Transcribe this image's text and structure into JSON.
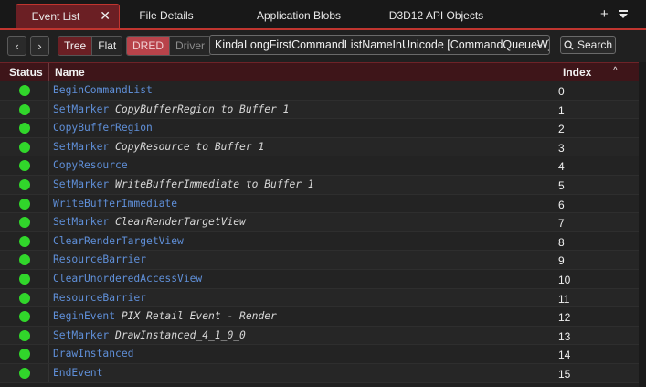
{
  "tabs": [
    {
      "label": "Event List",
      "active": true,
      "closable": true
    },
    {
      "label": "File Details",
      "active": false
    },
    {
      "label": "Application Blobs",
      "active": false
    },
    {
      "label": "D3D12 API Objects",
      "active": false
    }
  ],
  "tabbar": {
    "add_icon": "plus-icon",
    "menu_icon": "dropdown-menu-icon"
  },
  "toolbar": {
    "back_icon": "chevron-left-icon",
    "forward_icon": "chevron-right-icon",
    "view_mode": {
      "options": [
        "Tree",
        "Flat"
      ],
      "selected": "Tree"
    },
    "source_mode": {
      "options": [
        "DRED",
        "Driver"
      ],
      "selected": "DRED"
    },
    "command_list": "KindaLongFirstCommandListNameInUnicode [CommandQueueW]",
    "search_label": "Search"
  },
  "table": {
    "columns": [
      "Status",
      "Name",
      "Index"
    ],
    "sort_indicator": "^",
    "rows": [
      {
        "status": "ok",
        "cmd": "BeginCommandList",
        "args": "",
        "index": "0"
      },
      {
        "status": "ok",
        "cmd": "SetMarker",
        "args": "CopyBufferRegion to Buffer 1",
        "index": "1"
      },
      {
        "status": "ok",
        "cmd": "CopyBufferRegion",
        "args": "",
        "index": "2"
      },
      {
        "status": "ok",
        "cmd": "SetMarker",
        "args": "CopyResource to Buffer 1",
        "index": "3"
      },
      {
        "status": "ok",
        "cmd": "CopyResource",
        "args": "",
        "index": "4"
      },
      {
        "status": "ok",
        "cmd": "SetMarker",
        "args": "WriteBufferImmediate to Buffer 1",
        "index": "5"
      },
      {
        "status": "ok",
        "cmd": "WriteBufferImmediate",
        "args": "",
        "index": "6"
      },
      {
        "status": "ok",
        "cmd": "SetMarker",
        "args": "ClearRenderTargetView",
        "index": "7"
      },
      {
        "status": "ok",
        "cmd": "ClearRenderTargetView",
        "args": "",
        "index": "8"
      },
      {
        "status": "ok",
        "cmd": "ResourceBarrier",
        "args": "",
        "index": "9"
      },
      {
        "status": "ok",
        "cmd": "ClearUnorderedAccessView",
        "args": "",
        "index": "10"
      },
      {
        "status": "ok",
        "cmd": "ResourceBarrier",
        "args": "",
        "index": "11"
      },
      {
        "status": "ok",
        "cmd": "BeginEvent",
        "args": "PIX Retail Event - Render",
        "index": "12"
      },
      {
        "status": "ok",
        "cmd": "SetMarker",
        "args": "DrawInstanced_4_1_0_0",
        "index": "13"
      },
      {
        "status": "ok",
        "cmd": "DrawInstanced",
        "args": "",
        "index": "14"
      },
      {
        "status": "ok",
        "cmd": "EndEvent",
        "args": "",
        "index": "15"
      }
    ]
  },
  "colors": {
    "accent": "#c0352f",
    "active_tab": "#6b1f24",
    "status_ok": "#31d62b",
    "command_text": "#5f8fd8"
  }
}
